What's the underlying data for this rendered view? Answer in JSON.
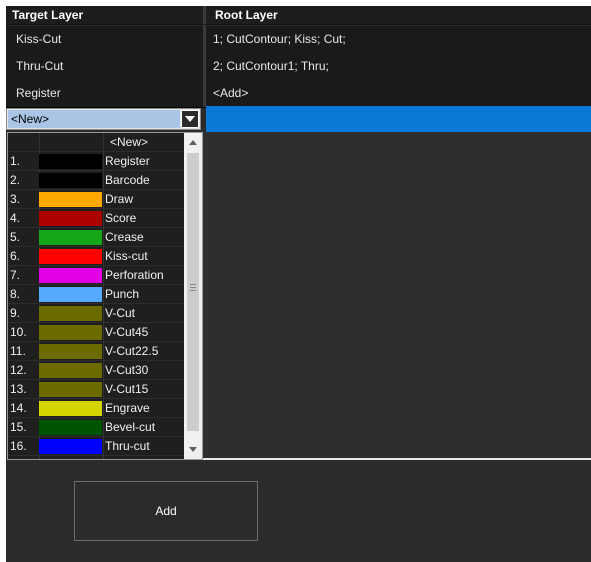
{
  "table": {
    "headers": {
      "target": "Target Layer",
      "root": "Root Layer"
    },
    "rows": [
      {
        "target": "Kiss-Cut",
        "root": "1; CutContour; Kiss; Cut;"
      },
      {
        "target": "Thru-Cut",
        "root": "2; CutContour1; Thru;"
      },
      {
        "target": "Register",
        "root": "<Add>"
      }
    ],
    "new_row": {
      "combo_value": "<New>"
    }
  },
  "dropdown": {
    "header": "<New>",
    "items": [
      {
        "num": "1.",
        "color": "#000000",
        "name": "Register"
      },
      {
        "num": "2.",
        "color": "#000000",
        "name": "Barcode"
      },
      {
        "num": "3.",
        "color": "#ffa800",
        "name": "Draw"
      },
      {
        "num": "4.",
        "color": "#aa0000",
        "name": "Score"
      },
      {
        "num": "5.",
        "color": "#16a516",
        "name": "Crease"
      },
      {
        "num": "6.",
        "color": "#ff0000",
        "name": "Kiss-cut"
      },
      {
        "num": "7.",
        "color": "#e400e4",
        "name": "Perforation"
      },
      {
        "num": "8.",
        "color": "#55aaff",
        "name": "Punch"
      },
      {
        "num": "9.",
        "color": "#6b6b00",
        "name": "V-Cut"
      },
      {
        "num": "10.",
        "color": "#6b6b00",
        "name": "V-Cut45"
      },
      {
        "num": "11.",
        "color": "#6b6b00",
        "name": "V-Cut22.5"
      },
      {
        "num": "12.",
        "color": "#6b6b00",
        "name": "V-Cut30"
      },
      {
        "num": "13.",
        "color": "#6b6b00",
        "name": "V-Cut15"
      },
      {
        "num": "14.",
        "color": "#d4d400",
        "name": "Engrave"
      },
      {
        "num": "15.",
        "color": "#005500",
        "name": "Bevel-cut"
      },
      {
        "num": "16.",
        "color": "#0000ff",
        "name": "Thru-cut"
      }
    ]
  },
  "buttons": {
    "add": "Add"
  },
  "colors": {
    "selection": "#0a78d7",
    "background": "#2b2b2b"
  }
}
